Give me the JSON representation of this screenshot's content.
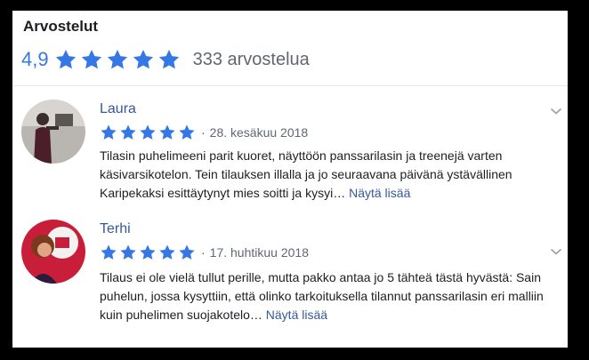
{
  "header": {
    "title": "Arvostelut",
    "average": "4,9",
    "count_label": "333 arvostelua",
    "star_color": "#3578e5"
  },
  "reviews": [
    {
      "name": "Laura",
      "rating": 5,
      "date": "28. kesäkuu 2018",
      "text": "Tilasin puhelimeeni parit kuoret, näyttöön panssarilasin ja treenejä varten käsivarsikotelon. Tein tilauksen illalla ja jo seuraavana päivänä ystävällinen Karipekaksi esittäytynyt mies soitti ja kysyi…",
      "more_label": "Näytä lisää"
    },
    {
      "name": "Terhi",
      "rating": 5,
      "date": "17. huhtikuu 2018",
      "text": "Tilaus ei ole vielä tullut perille, mutta pakko antaa jo 5 tähteä tästä hyvästä: Sain puhelun, jossa kysyttiin, että olinko tarkoituksella tilannut panssarilasin eri malliin kuin puhelimen suojakotelo…",
      "more_label": "Näytä lisää"
    }
  ]
}
